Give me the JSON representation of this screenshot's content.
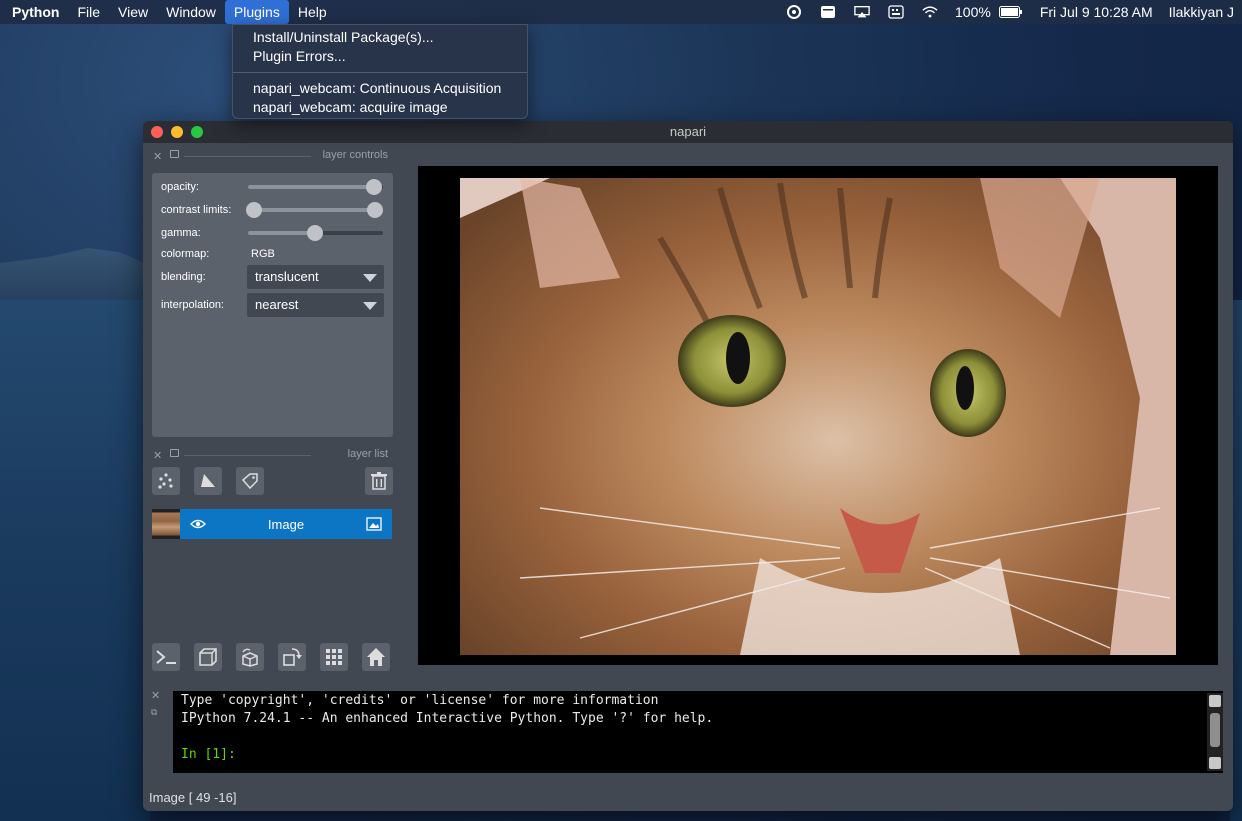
{
  "menubar": {
    "app": "Python",
    "items": [
      "File",
      "View",
      "Window",
      "Plugins",
      "Help"
    ],
    "active": "Plugins",
    "battery_pct": "100%",
    "clock": "Fri Jul 9  10:28 AM",
    "user": "Ilakkiyan J"
  },
  "plugins_menu": {
    "items": [
      "Install/Uninstall Package(s)...",
      "Plugin Errors...",
      "napari_webcam: Continuous Acquisition",
      "napari_webcam: acquire image"
    ]
  },
  "window": {
    "title": "napari"
  },
  "layer_controls": {
    "header": "layer controls",
    "opacity_label": "opacity:",
    "opacity_value": 1.0,
    "contrast_label": "contrast limits:",
    "contrast_range": [
      0.0,
      1.0
    ],
    "gamma_label": "gamma:",
    "gamma_value": 0.5,
    "colormap_label": "colormap:",
    "colormap_value": "RGB",
    "blending_label": "blending:",
    "blending_value": "translucent",
    "interpolation_label": "interpolation:",
    "interpolation_value": "nearest"
  },
  "layer_list": {
    "header": "layer list",
    "layers": [
      {
        "name": "Image"
      }
    ]
  },
  "console": {
    "line1": "Type 'copyright', 'credits' or 'license' for more information",
    "line2": "IPython 7.24.1 -- An enhanced Interactive Python. Type '?' for help.",
    "prompt": "In [1]:"
  },
  "status": {
    "text": "Image [ 49 -16]"
  },
  "colors": {
    "accent": "#2f6fd6",
    "layer_selected": "#0d76c4",
    "prompt_green": "#5fd700"
  },
  "icons": [
    "control-center-icon",
    "notes-icon",
    "airplay-icon",
    "keyboard-icon",
    "wifi-icon",
    "battery-icon"
  ]
}
